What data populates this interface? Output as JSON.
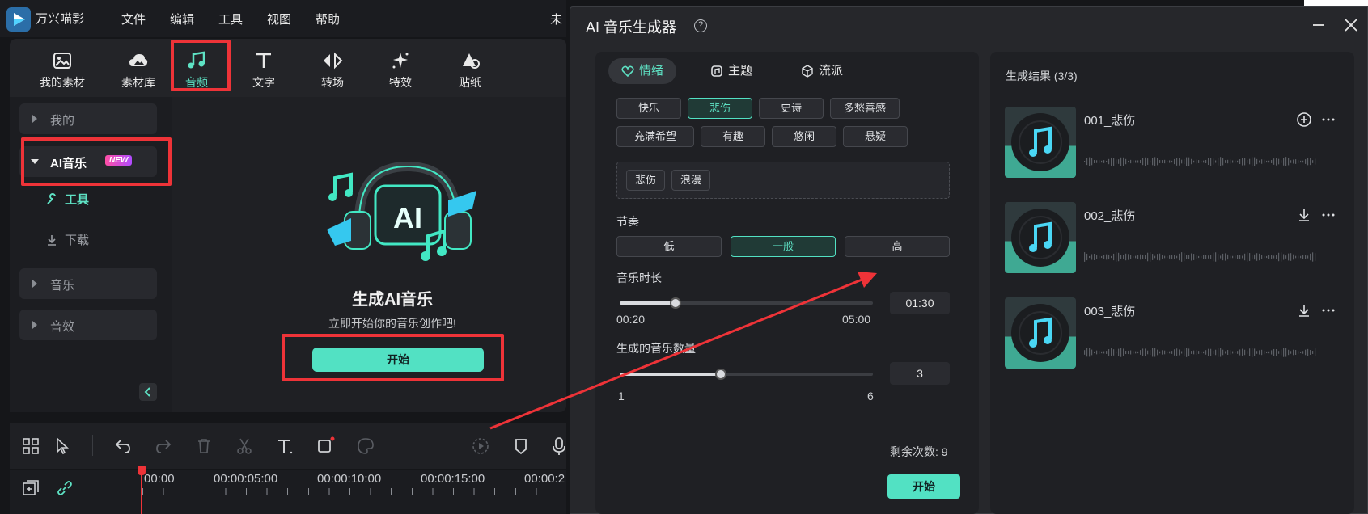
{
  "app": {
    "name": "万兴喵影",
    "menu": [
      "文件",
      "编辑",
      "工具",
      "视图",
      "帮助"
    ],
    "title_fragment": "未"
  },
  "toolbar": [
    {
      "label": "我的素材",
      "icon": "image-icon"
    },
    {
      "label": "素材库",
      "icon": "cloud-image-icon"
    },
    {
      "label": "音频",
      "icon": "music-note-icon",
      "active": true
    },
    {
      "label": "文字",
      "icon": "text-icon"
    },
    {
      "label": "转场",
      "icon": "transition-icon"
    },
    {
      "label": "特效",
      "icon": "sparkle-icon"
    },
    {
      "label": "贴纸",
      "icon": "sticker-icon"
    }
  ],
  "sidebar": {
    "mine": "我的",
    "ai_music": "AI音乐",
    "new_badge": "NEW",
    "tools": "工具",
    "download": "下载",
    "music": "音乐",
    "sfx": "音效"
  },
  "hero": {
    "title": "生成AI音乐",
    "subtitle": "立即开始你的音乐创作吧!",
    "start": "开始",
    "art_text": "AI"
  },
  "timeline": {
    "timecodes": [
      "00:00",
      "00:00:05:00",
      "00:00:10:00",
      "00:00:15:00",
      "00:00:2"
    ]
  },
  "dialog": {
    "title": "AI 音乐生成器",
    "help": "?",
    "tabs": [
      "情绪",
      "主题",
      "流派"
    ],
    "moods_row1": [
      "快乐",
      "悲伤",
      "史诗",
      "多愁善感"
    ],
    "moods_row2": [
      "充满希望",
      "有趣",
      "悠闲",
      "悬疑"
    ],
    "selected_mood": "悲伤",
    "selected_tags": [
      "悲伤",
      "浪漫"
    ],
    "rhythm_label": "节奏",
    "rhythm_options": [
      "低",
      "一般",
      "高"
    ],
    "rhythm_selected": "一般",
    "duration_label": "音乐时长",
    "duration_min": "00:20",
    "duration_max": "05:00",
    "duration_value": "01:30",
    "duration_level": 0.22,
    "count_label": "生成的音乐数量",
    "count_min": "1",
    "count_max": "6",
    "count_value": "3",
    "count_level": 0.4,
    "remaining": "剩余次数: 9",
    "start": "开始",
    "results_title": "生成结果 (3/3)",
    "results": [
      {
        "name": "001_悲伤",
        "action": "add-icon"
      },
      {
        "name": "002_悲伤",
        "action": "download-icon"
      },
      {
        "name": "003_悲伤",
        "action": "download-icon"
      }
    ]
  },
  "colors": {
    "accent": "#52e1c3",
    "highlight": "#ee3338",
    "panel": "#1f2024"
  }
}
